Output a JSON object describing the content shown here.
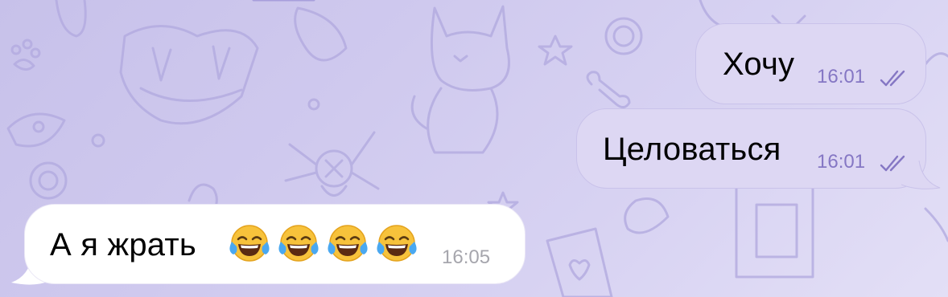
{
  "chat": {
    "messages": [
      {
        "direction": "outgoing",
        "text": "Хочу",
        "time": "16:01",
        "status": "read"
      },
      {
        "direction": "outgoing",
        "text": "Целоваться",
        "time": "16:01",
        "status": "read"
      },
      {
        "direction": "incoming",
        "text": "А я жрать",
        "emoji": [
          "face-with-tears-of-joy",
          "face-with-tears-of-joy",
          "face-with-tears-of-joy",
          "face-with-tears-of-joy"
        ],
        "time": "16:05"
      }
    ]
  },
  "colors": {
    "background": "#cdc7ed",
    "outgoing_bubble": "#ddd7f3",
    "incoming_bubble": "#ffffff",
    "outgoing_meta": "#8577c4",
    "incoming_meta": "#a6a6ad"
  }
}
